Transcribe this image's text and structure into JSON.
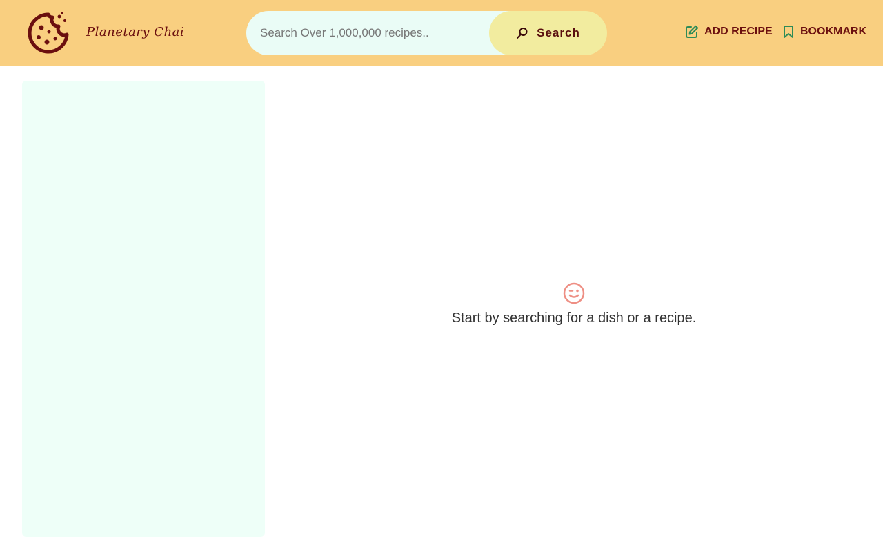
{
  "header": {
    "brand_name": "Planetary Chai",
    "logo_icon": "cookie-icon",
    "search": {
      "placeholder": "Search Over 1,000,000 recipes..",
      "value": "",
      "button_label": "Search",
      "button_icon": "search-icon"
    },
    "nav": {
      "add_recipe_label": "ADD RECIPE",
      "add_recipe_icon": "edit-icon",
      "bookmark_label": "BOOKMARK",
      "bookmark_icon": "bookmark-icon"
    }
  },
  "main": {
    "empty_icon": "wink-smile-icon",
    "empty_message": "Start by searching for a dish or a recipe."
  },
  "colors": {
    "header_bg": "#f9cf80",
    "brand": "#6b0f0f",
    "search_bg": "#eafcf6",
    "search_button_bg": "#f2ec9f",
    "sidebar_bg": "#eefff8",
    "accent_green": "#2e8b57",
    "smile": "#ee8f84"
  }
}
